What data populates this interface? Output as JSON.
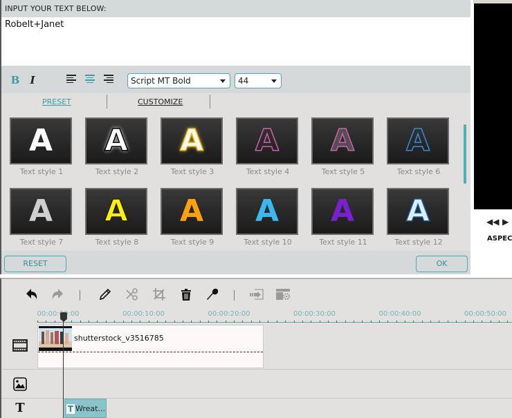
{
  "editor": {
    "input_label": "INPUT YOUR TEXT BELOW:",
    "input_value": "Robelt+Janet",
    "format": {
      "bold_label": "B",
      "italic_label": "I",
      "alignment_selected": "center",
      "font": "Script MT Bold",
      "size": "44"
    },
    "tabs": [
      {
        "label": "PRESET",
        "active": true
      },
      {
        "label": "CUSTOMIZE",
        "active": false
      }
    ],
    "styles": [
      {
        "label": "Text style 1",
        "fill": "#ffffff",
        "stroke": "none",
        "glow": "none"
      },
      {
        "label": "Text style 2",
        "fill": "#ffffff",
        "stroke": "#000000",
        "glow": "#ffffff"
      },
      {
        "label": "Text style 3",
        "fill": "#fffbe8",
        "stroke": "#e0b020",
        "glow": "#e0b020"
      },
      {
        "label": "Text style 4",
        "fill": "transparent",
        "stroke": "#d65cb0",
        "glow": "none"
      },
      {
        "label": "Text style 5",
        "fill": "#5a4a55",
        "stroke": "#c06aa8",
        "glow": "none"
      },
      {
        "label": "Text style 6",
        "fill": "transparent",
        "stroke": "#3a8ad8",
        "glow": "none"
      },
      {
        "label": "Text style 7",
        "fill": "#cfcfcf",
        "stroke": "none",
        "glow": "none"
      },
      {
        "label": "Text style 8",
        "fill": "#ffee10",
        "stroke": "#222200",
        "glow": "none"
      },
      {
        "label": "Text style 9",
        "fill": "#ffa010",
        "stroke": "none",
        "glow": "none"
      },
      {
        "label": "Text style 10",
        "fill": "#3ab8f0",
        "stroke": "none",
        "glow": "none"
      },
      {
        "label": "Text style 11",
        "fill": "#7a20d0",
        "stroke": "none",
        "glow": "none"
      },
      {
        "label": "Text style 12",
        "fill": "#d8f0ff",
        "stroke": "#1a5aa0",
        "glow": "none"
      }
    ],
    "reset_label": "RESET",
    "ok_label": "OK"
  },
  "preview": {
    "aspect_label": "ASPECT",
    "prev_icon": "◀◀",
    "play_icon": "▶"
  },
  "timeline": {
    "toolbar": [
      {
        "name": "undo-icon"
      },
      {
        "name": "redo-icon"
      },
      {
        "name": "edit-icon"
      },
      {
        "name": "split-icon"
      },
      {
        "name": "crop-icon"
      },
      {
        "name": "delete-icon"
      },
      {
        "name": "record-voiceover-icon"
      },
      {
        "name": "export-icon"
      },
      {
        "name": "settings-icon"
      }
    ],
    "ruler_labels": [
      "00:00:00:00",
      "00:00:10:00",
      "00:00:20:00",
      "00:00:30:00",
      "00:00:40:00",
      "00:00:50:00"
    ],
    "video_clip_name": "shutterstock_v3516785",
    "text_clip_icon": "T",
    "text_clip_name": "Wreat..."
  },
  "colors": {
    "accent": "#3a9ea5",
    "panel_bg": "#d5d9d9",
    "timeline_bg": "#e3e1e0"
  }
}
